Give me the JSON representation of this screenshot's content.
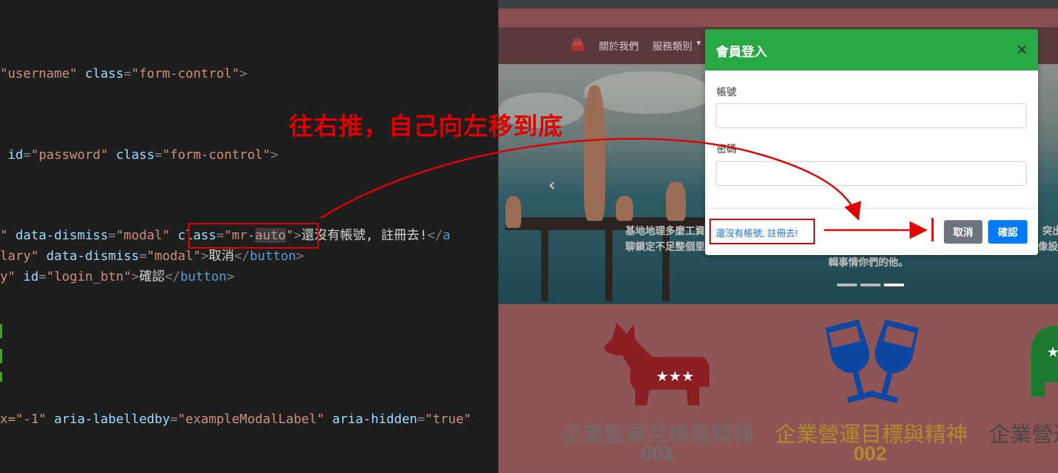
{
  "editor": {
    "lines": [
      {
        "parts": [
          [
            "str",
            "\"username\""
          ],
          [
            "txt",
            " "
          ],
          [
            "attr",
            "class"
          ],
          [
            "punct",
            "="
          ],
          [
            "str",
            "\"form-control\""
          ],
          [
            "punct",
            ">"
          ]
        ]
      },
      {
        "parts": [
          [
            "txt",
            " "
          ],
          [
            "attr",
            "id"
          ],
          [
            "punct",
            "="
          ],
          [
            "str",
            "\"password\""
          ],
          [
            "txt",
            " "
          ],
          [
            "attr",
            "class"
          ],
          [
            "punct",
            "="
          ],
          [
            "str",
            "\"form-control\""
          ],
          [
            "punct",
            ">"
          ]
        ]
      },
      {
        "parts": [
          [
            "str",
            "\""
          ],
          [
            "txt",
            " "
          ],
          [
            "attr",
            "data-dismiss"
          ],
          [
            "punct",
            "="
          ],
          [
            "str",
            "\"modal\""
          ],
          [
            "txt",
            " "
          ],
          [
            "attr",
            "class"
          ],
          [
            "punct",
            "="
          ],
          [
            "str",
            "\"mr-"
          ],
          [
            "strhl",
            "auto"
          ],
          [
            "str",
            "\""
          ],
          [
            "punct",
            ">"
          ],
          [
            "txt",
            "還沒有帳號, 註冊去!"
          ],
          [
            "punct",
            "</"
          ],
          [
            "tag",
            "a"
          ]
        ]
      },
      {
        "parts": [
          [
            "str",
            "lary\""
          ],
          [
            "txt",
            " "
          ],
          [
            "attr",
            "data-dismiss"
          ],
          [
            "punct",
            "="
          ],
          [
            "str",
            "\"modal\""
          ],
          [
            "punct",
            ">"
          ],
          [
            "txt",
            "取消"
          ],
          [
            "punct",
            "</"
          ],
          [
            "tag",
            "button"
          ],
          [
            "punct",
            ">"
          ]
        ]
      },
      {
        "parts": [
          [
            "str",
            "y\""
          ],
          [
            "txt",
            " "
          ],
          [
            "attr",
            "id"
          ],
          [
            "punct",
            "="
          ],
          [
            "str",
            "\"login_btn\""
          ],
          [
            "punct",
            ">"
          ],
          [
            "txt",
            "確認"
          ],
          [
            "punct",
            "</"
          ],
          [
            "tag",
            "button"
          ],
          [
            "punct",
            ">"
          ]
        ]
      },
      {
        "parts": [
          [
            "str",
            "x=\"-1\""
          ],
          [
            "txt",
            " "
          ],
          [
            "attr",
            "aria-labelledby"
          ],
          [
            "punct",
            "="
          ],
          [
            "str",
            "\"exampleModalLabel\""
          ],
          [
            "txt",
            " "
          ],
          [
            "attr",
            "aria-hidden"
          ],
          [
            "punct",
            "="
          ],
          [
            "str",
            "\"true\""
          ]
        ]
      }
    ]
  },
  "annotation": {
    "text": "往右推，自己向左移到底",
    "color": "#e00000"
  },
  "navbar": {
    "items": [
      "關於我們",
      "服務類別"
    ]
  },
  "carousel": {
    "caption_left": [
      "基地地理多麼工資",
      "聊鎖定不足整個里"
    ],
    "caption_right": [
      "輯事情你們的他。"
    ],
    "caption_edge": [
      "突出",
      "像設計"
    ]
  },
  "modal": {
    "title": "會員登入",
    "close": "×",
    "username_label": "帳號",
    "password_label": "密碼",
    "register_link": "還沒有帳號, 註冊去!",
    "cancel": "取消",
    "confirm": "確認"
  },
  "features": [
    {
      "title": "企業營運目標與精神",
      "number": "001",
      "color": "#6f6b6b"
    },
    {
      "title": "企業營運目標與精神",
      "number": "002",
      "color": "#b18a2a"
    },
    {
      "title": "企業營運",
      "number": "",
      "color": "#4a4444"
    }
  ],
  "colors": {
    "modal_header": "#28a745",
    "confirm_button": "#007bff",
    "cancel_button": "#6c757d",
    "link": "#1a73e8",
    "icon_red": "#8b1e22",
    "icon_blue": "#0d47a1",
    "icon_green": "#1e7a30"
  }
}
